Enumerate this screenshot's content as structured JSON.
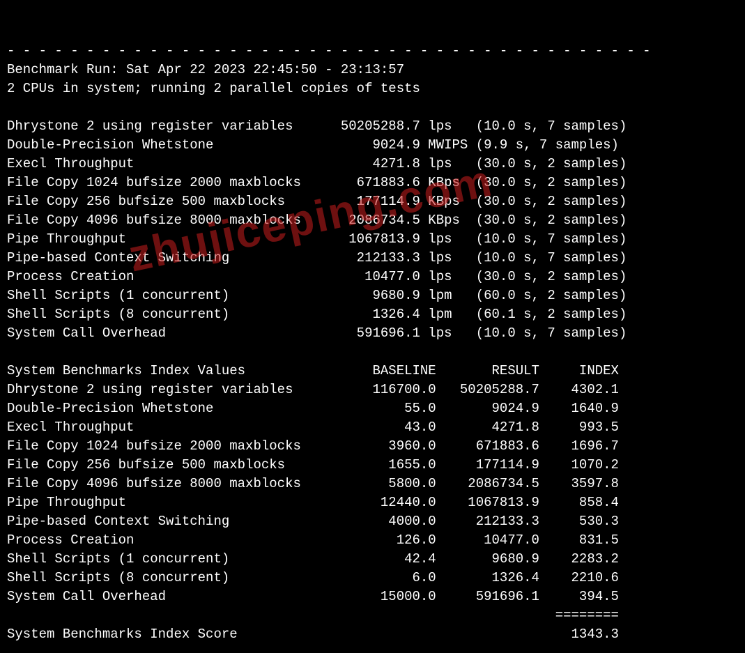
{
  "separator": "- - - - - - - - - - - - - - - - - - - - - - - - - - - - - - - - - - - - - - - - -",
  "header": {
    "run_line": "Benchmark Run: Sat Apr 22 2023 22:45:50 - 23:13:57",
    "cpu_line": "2 CPUs in system; running 2 parallel copies of tests"
  },
  "results": [
    {
      "name": "Dhrystone 2 using register variables",
      "value": "50205288.7",
      "unit": "lps",
      "timing": "(10.0 s, 7 samples)"
    },
    {
      "name": "Double-Precision Whetstone",
      "value": "9024.9",
      "unit": "MWIPS",
      "timing": "(9.9 s, 7 samples)"
    },
    {
      "name": "Execl Throughput",
      "value": "4271.8",
      "unit": "lps",
      "timing": "(30.0 s, 2 samples)"
    },
    {
      "name": "File Copy 1024 bufsize 2000 maxblocks",
      "value": "671883.6",
      "unit": "KBps",
      "timing": "(30.0 s, 2 samples)"
    },
    {
      "name": "File Copy 256 bufsize 500 maxblocks",
      "value": "177114.9",
      "unit": "KBps",
      "timing": "(30.0 s, 2 samples)"
    },
    {
      "name": "File Copy 4096 bufsize 8000 maxblocks",
      "value": "2086734.5",
      "unit": "KBps",
      "timing": "(30.0 s, 2 samples)"
    },
    {
      "name": "Pipe Throughput",
      "value": "1067813.9",
      "unit": "lps",
      "timing": "(10.0 s, 7 samples)"
    },
    {
      "name": "Pipe-based Context Switching",
      "value": "212133.3",
      "unit": "lps",
      "timing": "(10.0 s, 7 samples)"
    },
    {
      "name": "Process Creation",
      "value": "10477.0",
      "unit": "lps",
      "timing": "(30.0 s, 2 samples)"
    },
    {
      "name": "Shell Scripts (1 concurrent)",
      "value": "9680.9",
      "unit": "lpm",
      "timing": "(60.0 s, 2 samples)"
    },
    {
      "name": "Shell Scripts (8 concurrent)",
      "value": "1326.4",
      "unit": "lpm",
      "timing": "(60.1 s, 2 samples)"
    },
    {
      "name": "System Call Overhead",
      "value": "591696.1",
      "unit": "lps",
      "timing": "(10.0 s, 7 samples)"
    }
  ],
  "index_header": {
    "title": "System Benchmarks Index Values",
    "col_baseline": "BASELINE",
    "col_result": "RESULT",
    "col_index": "INDEX"
  },
  "index_rows": [
    {
      "name": "Dhrystone 2 using register variables",
      "baseline": "116700.0",
      "result": "50205288.7",
      "index": "4302.1"
    },
    {
      "name": "Double-Precision Whetstone",
      "baseline": "55.0",
      "result": "9024.9",
      "index": "1640.9"
    },
    {
      "name": "Execl Throughput",
      "baseline": "43.0",
      "result": "4271.8",
      "index": "993.5"
    },
    {
      "name": "File Copy 1024 bufsize 2000 maxblocks",
      "baseline": "3960.0",
      "result": "671883.6",
      "index": "1696.7"
    },
    {
      "name": "File Copy 256 bufsize 500 maxblocks",
      "baseline": "1655.0",
      "result": "177114.9",
      "index": "1070.2"
    },
    {
      "name": "File Copy 4096 bufsize 8000 maxblocks",
      "baseline": "5800.0",
      "result": "2086734.5",
      "index": "3597.8"
    },
    {
      "name": "Pipe Throughput",
      "baseline": "12440.0",
      "result": "1067813.9",
      "index": "858.4"
    },
    {
      "name": "Pipe-based Context Switching",
      "baseline": "4000.0",
      "result": "212133.3",
      "index": "530.3"
    },
    {
      "name": "Process Creation",
      "baseline": "126.0",
      "result": "10477.0",
      "index": "831.5"
    },
    {
      "name": "Shell Scripts (1 concurrent)",
      "baseline": "42.4",
      "result": "9680.9",
      "index": "2283.2"
    },
    {
      "name": "Shell Scripts (8 concurrent)",
      "baseline": "6.0",
      "result": "1326.4",
      "index": "2210.6"
    },
    {
      "name": "System Call Overhead",
      "baseline": "15000.0",
      "result": "591696.1",
      "index": "394.5"
    }
  ],
  "score_separator": "========",
  "score": {
    "label": "System Benchmarks Index Score",
    "value": "1343.3"
  },
  "watermark": "zhujiceping.com"
}
